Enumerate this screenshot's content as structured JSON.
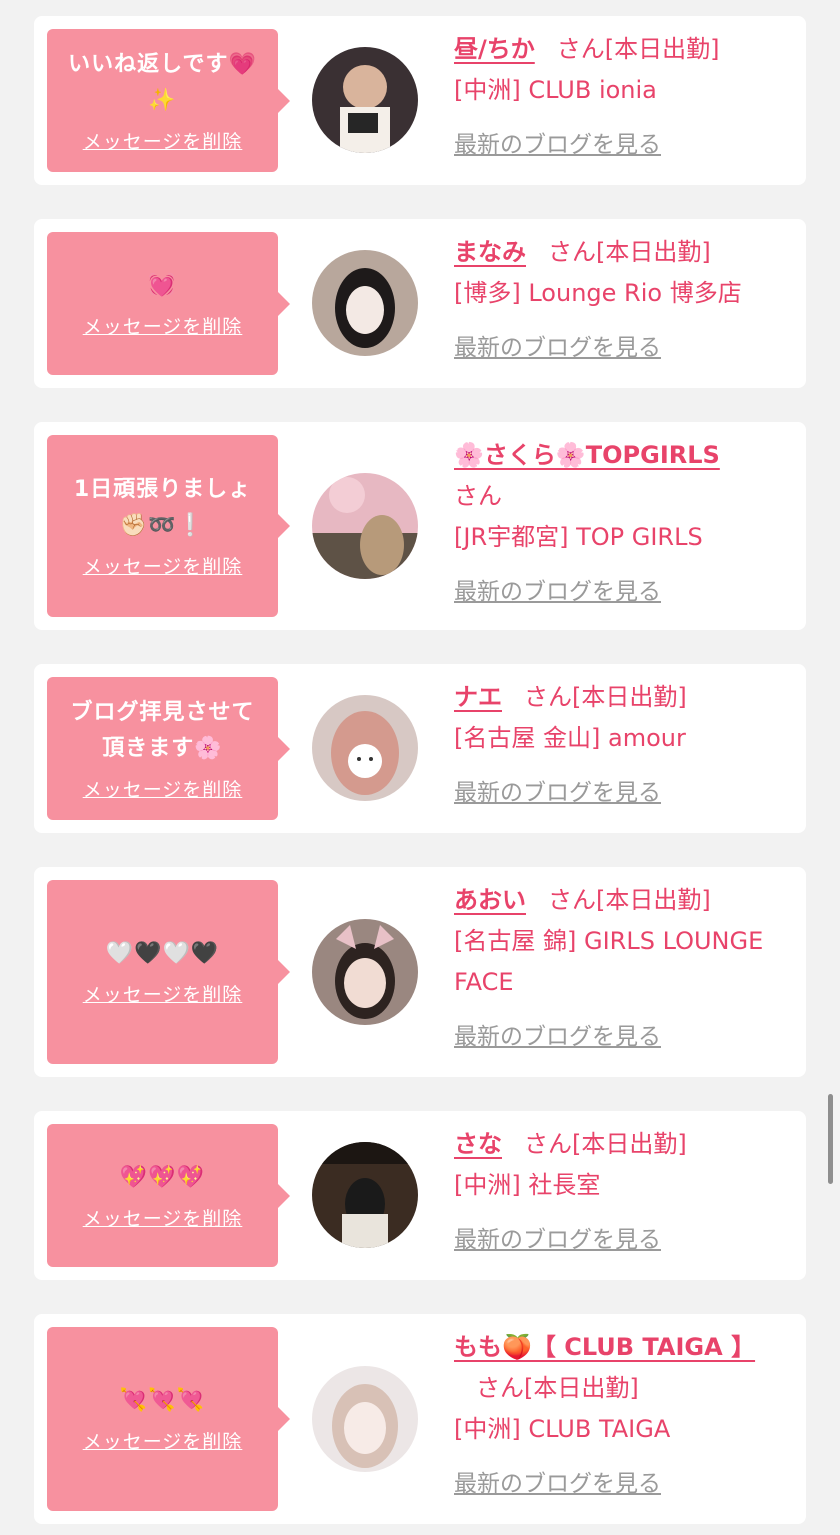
{
  "labels": {
    "delete_message": "メッセージを削除",
    "latest_blog": "最新のブログを見る",
    "honorific": "さん"
  },
  "cards": [
    {
      "message": "いいね返しです💗\n✨",
      "name": "昼/ちか",
      "status": "[本日出勤]",
      "shop": "[中洲] CLUB ionia"
    },
    {
      "message": "💓",
      "name": "まなみ",
      "status": "[本日出勤]",
      "shop": "[博多] Lounge Rio 博多店"
    },
    {
      "message": "1日頑張りましょ\n✊🏻➿❕",
      "name": "🌸さくら🌸TOPGIRLS",
      "status": "",
      "shop": "[JR宇都宮] TOP GIRLS"
    },
    {
      "message": "ブログ拝見させて\n頂きます🌸",
      "name": "ナエ",
      "status": "[本日出勤]",
      "shop": "[名古屋 金山] amour"
    },
    {
      "message": "🤍🖤🤍🖤",
      "name": "あおい",
      "status": "[本日出勤]",
      "shop": "[名古屋 錦] GIRLS LOUNGE FACE"
    },
    {
      "message": "💖💖💖",
      "name": "さな",
      "status": "[本日出勤]",
      "shop": "[中洲] 社長室"
    },
    {
      "message": "💘💘💘",
      "name": "もも🍑【 CLUB TAIGA 】",
      "status": "[本日出勤]",
      "shop": "[中洲] CLUB TAIGA"
    }
  ]
}
